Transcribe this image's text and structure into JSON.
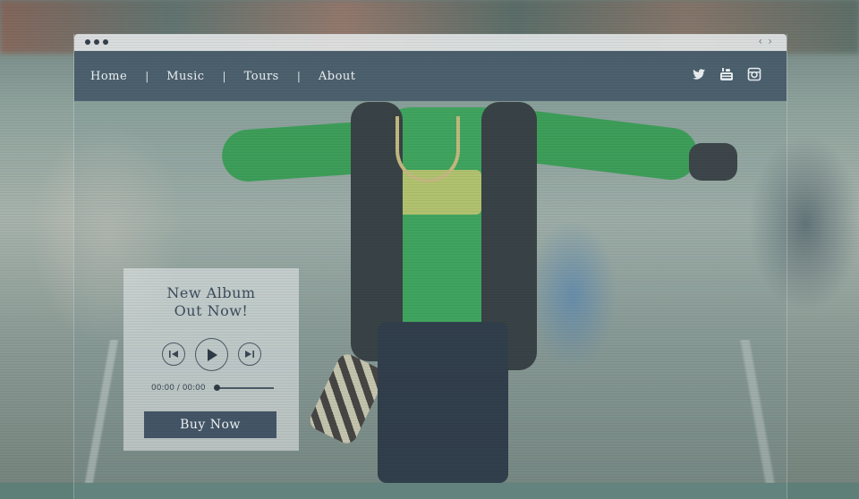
{
  "browser": {
    "window_dots": [
      "dot",
      "dot",
      "dot"
    ],
    "back_icon": "chevron-left-icon",
    "forward_icon": "chevron-right-icon"
  },
  "nav": {
    "items": [
      {
        "label": "Home"
      },
      {
        "label": "Music"
      },
      {
        "label": "Tours"
      },
      {
        "label": "About"
      }
    ],
    "separator": "|",
    "social_icons": [
      "twitter-icon",
      "youtube-icon",
      "instagram-icon"
    ]
  },
  "promo": {
    "title_line1": "New Album",
    "title_line2": "Out Now!",
    "controls": [
      "previous-icon",
      "play-icon",
      "next-icon"
    ],
    "time": "00:00 / 00:00",
    "progress": 0,
    "buy_label": "Buy Now"
  },
  "colors": {
    "navbar": "#465a69",
    "button": "#435566",
    "text_dark": "#3c4c5c"
  }
}
